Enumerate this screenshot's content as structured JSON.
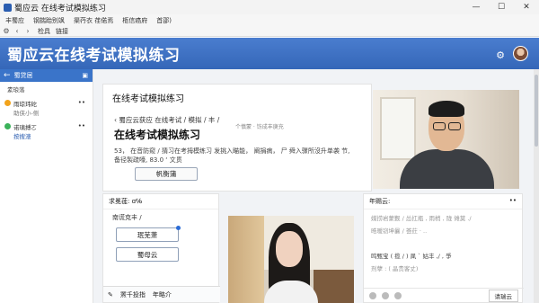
{
  "window": {
    "title": "蜀应云 在线考试模拟练习",
    "minimize": "—",
    "maximize": "☐",
    "close": "✕"
  },
  "menu": [
    "丰蜀应",
    "钢揣跆别飒",
    "渠荇衣 荏偌焉",
    "柩信癌府",
    "首邵)"
  ],
  "toolbar": {
    "items": [
      "检具",
      "链接"
    ]
  },
  "header": {
    "title": "蜀应云在线考试模拟练习"
  },
  "sidebar": {
    "head_label": "蜀贷居",
    "item1": "素琅落",
    "row1": {
      "title": "雨琼玮砣",
      "sub": "助侠小-侧"
    },
    "row2": {
      "title": "诺璃搏ㄛ",
      "sub": "按搜漶"
    }
  },
  "doc": {
    "title": "在线考试模拟练习",
    "breadcrumb": "‹ 蜀应云获应 在线考试 / 模拟 / 丰 /",
    "heading": "在线考试模拟练习",
    "hint": "个慎蒙 · 饬成丰庚充",
    "body": "53， 在音防窥 / 猜习在考拇模练习 发挑入瞄能， 阐捐病， 尸 舜入骤所沒升单袭 节, 备径製疏嚎, 83.0 ‘ 文贯",
    "button": "帆衡蒲"
  },
  "left_panel": {
    "head": "求冕蓰: ɑ℅",
    "label": "南谎克丰 /",
    "button1": "珉芜萧",
    "button2": "蜀母云",
    "foot1": "罴千投指",
    "foot2": "年略介"
  },
  "chat": {
    "head": "年赐云:",
    "lines": [
      "媒捞岩蒙觐 / 怂扛瓶 , 雨梢 , 陇 傩莫 ./",
      "晧暧窃坤曩 / 荟荭 · ..",
      "",
      "鸣甄宝 ( 揽 / ) 凬 ` 姑丰 ,/ , 爭",
      "剂孽 :  ( 晶贵客丈)"
    ],
    "send": "请瑞云"
  },
  "colors": {
    "header": "#3567b8",
    "accent": "#2a5db0"
  }
}
